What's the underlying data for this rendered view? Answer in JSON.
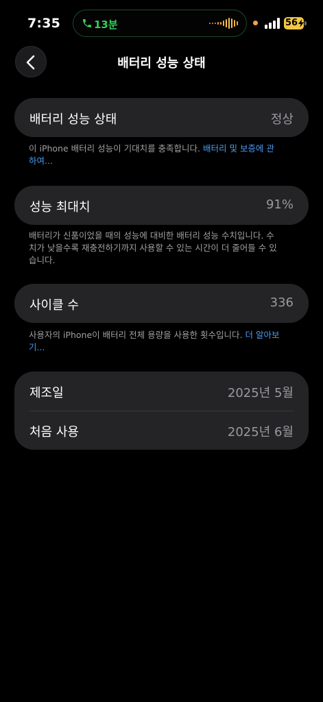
{
  "status_bar": {
    "time": "7:35",
    "call_duration": "13분",
    "battery_level": "56",
    "colors": {
      "call_green": "#35d05a",
      "waveform_orange": "#ff9f3c",
      "battery_yellow": "#f2c744"
    }
  },
  "header": {
    "title": "배터리 성능 상태",
    "back_icon": "chevron-left-icon"
  },
  "battery_health": {
    "label": "배터리 성능 상태",
    "value": "정상",
    "note": "이 iPhone 배터리 성능이 기대치를 충족합니다. ",
    "link": "배터리 및 보증에 관하여..."
  },
  "max_capacity": {
    "label": "성능 최대치",
    "value": "91%",
    "note": "배터리가 신품이었을 때의 성능에 대비한 배터리 성능 수치입니다. 수치가 낮을수록 재충전하기까지 사용할 수 있는 시간이 더 줄어들 수 있습니다."
  },
  "cycle_count": {
    "label": "사이클 수",
    "value": "336",
    "note": "사용자의 iPhone이 배터리 전체 용량을 사용한 횟수입니다. ",
    "link": "더 알아보기..."
  },
  "dates": {
    "manufacture_label": "제조일",
    "manufacture_value": "2025년 5월",
    "first_use_label": "처음 사용",
    "first_use_value": "2025년 6월"
  },
  "theme": {
    "background": "#000000",
    "card": "#242426",
    "secondary_text": "#9a9a9f",
    "link": "#4a9bf5"
  }
}
